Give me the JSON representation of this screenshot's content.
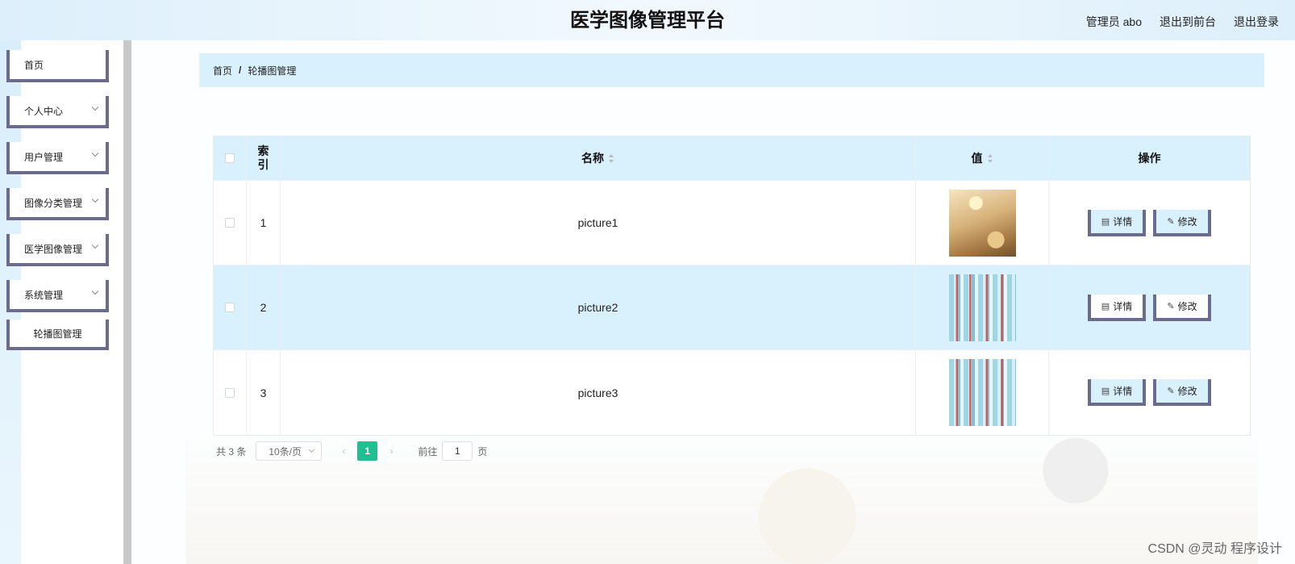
{
  "app": {
    "title": "医学图像管理平台"
  },
  "header": {
    "links": [
      "管理员 abo",
      "退出到前台",
      "退出登录"
    ]
  },
  "sidebar": {
    "items": [
      {
        "label": "首页",
        "expandable": false
      },
      {
        "label": "个人中心",
        "expandable": true
      },
      {
        "label": "用户管理",
        "expandable": true
      },
      {
        "label": "图像分类管理",
        "expandable": true
      },
      {
        "label": "医学图像管理",
        "expandable": true
      },
      {
        "label": "系统管理",
        "expandable": true
      }
    ],
    "subitem": {
      "label": "轮播图管理"
    }
  },
  "breadcrumb": {
    "home": "首页",
    "separator": "/",
    "current": "轮播图管理"
  },
  "table": {
    "headers": {
      "index": "索引",
      "name": "名称",
      "value": "值",
      "ops": "操作"
    },
    "rows": [
      {
        "index": "1",
        "name": "picture1",
        "image": "room-image"
      },
      {
        "index": "2",
        "name": "picture2",
        "image": "ecg-image"
      },
      {
        "index": "3",
        "name": "picture3",
        "image": "ecg-image"
      }
    ],
    "actions": {
      "detail": "详情",
      "edit": "修改"
    }
  },
  "pagination": {
    "total": "共 3 条",
    "page_size": "10条/页",
    "current_page": "1",
    "goto_label": "前往",
    "goto_value": "1",
    "page_unit": "页"
  },
  "watermark": "CSDN @灵动 程序设计",
  "colors": {
    "accent_blue": "#d9f0fd",
    "border_purple": "#6b6b8e",
    "page_active": "#1fbf8f"
  }
}
